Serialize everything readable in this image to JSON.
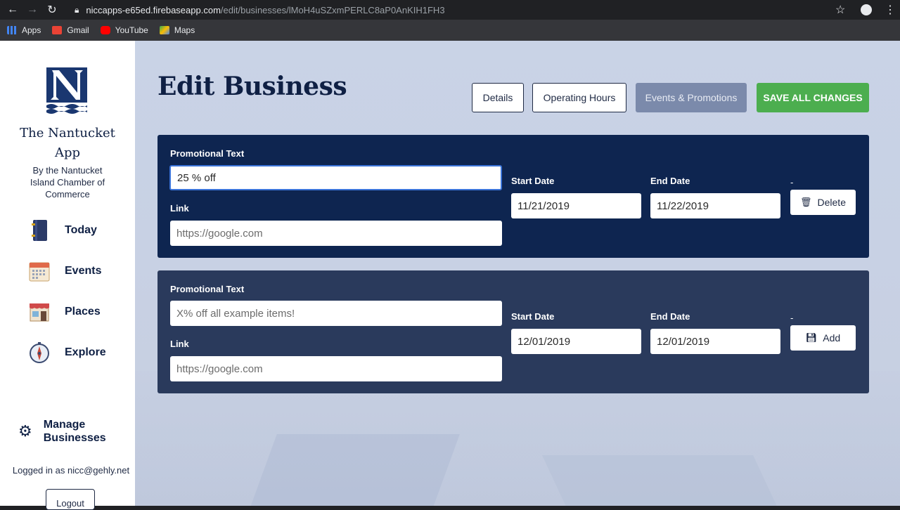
{
  "browser": {
    "url_host": "niccapps-e65ed.firebaseapp.com",
    "url_path": "/edit/businesses/lMoH4uSZxmPERLC8aP0AnKIH1FH3",
    "bookmarks": [
      {
        "label": "Apps",
        "color": "#4285f4"
      },
      {
        "label": "Gmail",
        "color": "#ea4335"
      },
      {
        "label": "YouTube",
        "color": "#ff0000"
      },
      {
        "label": "Maps",
        "color": "#34a853"
      }
    ]
  },
  "sidebar": {
    "app_name_line1": "The Nantucket",
    "app_name_line2": "App",
    "byline": "By the Nantucket Island Chamber of Commerce",
    "nav": [
      {
        "label": "Today",
        "icon": "notebook-icon"
      },
      {
        "label": "Events",
        "icon": "calendar-icon"
      },
      {
        "label": "Places",
        "icon": "storefront-icon"
      },
      {
        "label": "Explore",
        "icon": "compass-icon"
      }
    ],
    "manage_line1": "Manage",
    "manage_line2": "Businesses",
    "logged_in": "Logged in as nicc@gehly.net",
    "logout": "Logout"
  },
  "main": {
    "title": "Edit Business",
    "tabs": {
      "details": "Details",
      "hours": "Operating Hours",
      "events": "Events & Promotions",
      "save": "SAVE ALL CHANGES"
    },
    "promotions": [
      {
        "promo_label": "Promotional Text",
        "promo_value": "25 % off",
        "link_label": "Link",
        "link_placeholder": "https://google.com",
        "start_label": "Start Date",
        "start_value": "11/21/2019",
        "end_label": "End Date",
        "end_value": "11/22/2019",
        "dash": "-",
        "action": "Delete"
      },
      {
        "promo_label": "Promotional Text",
        "promo_placeholder": "X% off all example items!",
        "link_label": "Link",
        "link_placeholder": "https://google.com",
        "start_label": "Start Date",
        "start_value": "12/01/2019",
        "end_label": "End Date",
        "end_value": "12/01/2019",
        "dash": "-",
        "action": "Add"
      }
    ]
  },
  "colors": {
    "navy": "#0f2044",
    "card_active": "#0e2550",
    "card_new": "#2a3a5c",
    "save_green": "#4cae4f",
    "tab_selected": "#7b8aab"
  }
}
